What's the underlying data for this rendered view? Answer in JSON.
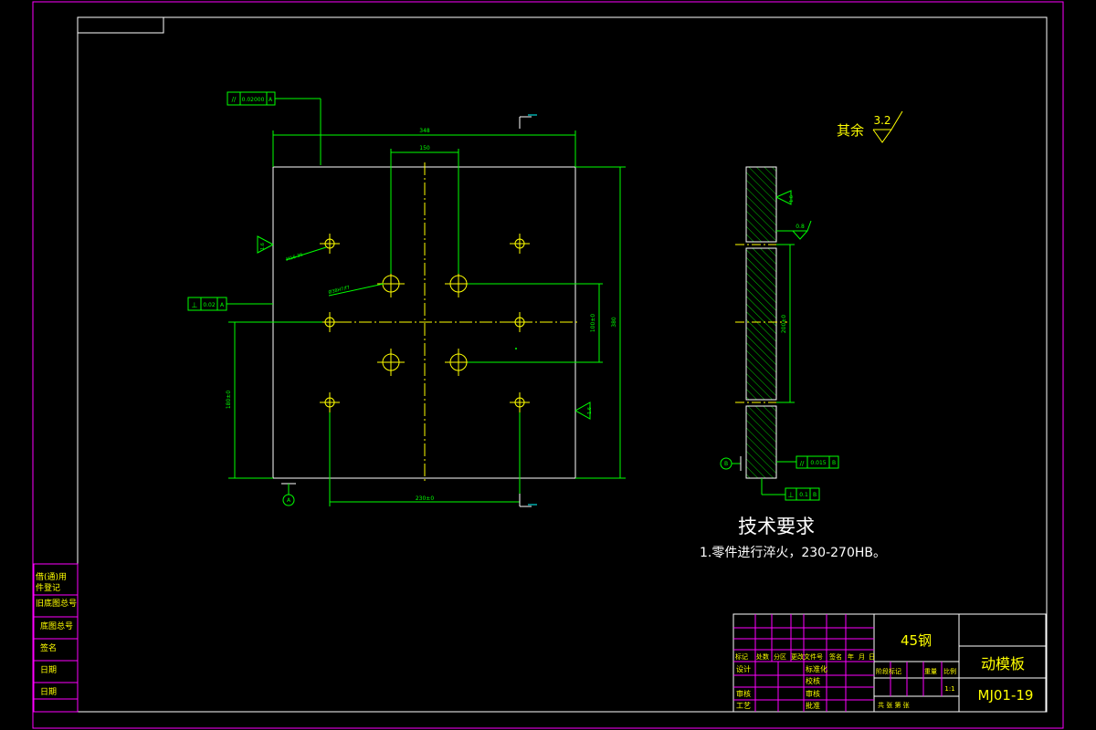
{
  "drawing": {
    "part_name": "动模板",
    "drawing_number": "MJ01-19",
    "material": "45钢",
    "scale": "1:1",
    "tech_title": "技术要求",
    "tech_note": "1.零件进行淬火，230-270HB。",
    "roughness_other_label": "其余",
    "roughness_other_value": "3.2"
  },
  "front_view": {
    "dim_width": "348",
    "dim_inner_width": "150",
    "dim_height": "380",
    "dim_half_height": "180±0",
    "dim_bottom": "230±0",
    "dim_right_inner": "100±0",
    "tol_parallel": "0.02000",
    "tol_parallel_datum": "A",
    "tol_perp": "0.02",
    "tol_perp_datum": "A",
    "datum_label": "A",
    "hole_label_small": "M16-36",
    "hole_label_large": "Ø38H7/f7",
    "rough_left": "1.6",
    "rough_right": "1.6"
  },
  "side_view": {
    "rough_top": "1.6",
    "rough_hole": "0.8",
    "dim_hole_spacing": "200±0",
    "tol_parallel": "0.015",
    "tol_parallel_datum": "B",
    "tol_perp": "0.1",
    "tol_perp_datum": "B",
    "datum_label": "B"
  },
  "left_strip": {
    "items": [
      "借(通)用",
      "件登记",
      "旧底图总号",
      "底图总号",
      "签名",
      "日期",
      "日期"
    ]
  },
  "title_block": {
    "row_labels": [
      "标记",
      "处数",
      "分区",
      "更改文件号",
      "签名",
      "年",
      "月",
      "日"
    ],
    "design": "设计",
    "standardize": "标准化",
    "review": "审核",
    "process": "工艺",
    "approve": "批准",
    "check": "校核",
    "proofread": "审核",
    "stage_mark": "阶段标记",
    "weight": "重量",
    "scale_label": "比例",
    "sheets": "共  张  第  张"
  }
}
